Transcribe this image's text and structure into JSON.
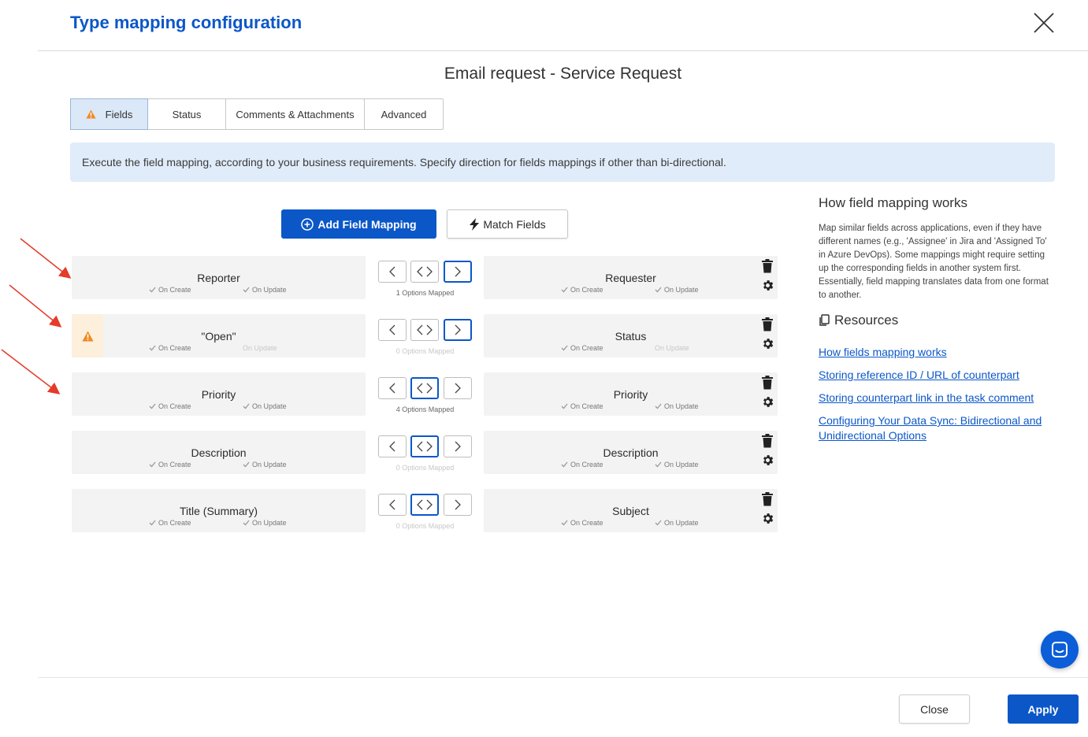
{
  "header": {
    "title": "Type mapping configuration"
  },
  "subtitle": "Email request - Service Request",
  "tabs": [
    {
      "label": "Fields",
      "active": true
    },
    {
      "label": "Status"
    },
    {
      "label": "Comments & Attachments"
    },
    {
      "label": "Advanced"
    }
  ],
  "info_banner": "Execute the field mapping, according to your business requirements. Specify direction for fields mappings if other than bi-directional.",
  "actions": {
    "add_label": "Add Field Mapping",
    "match_label": "Match Fields"
  },
  "mapping_labels": {
    "on_create": "On Create",
    "on_update": "On Update"
  },
  "mappings": [
    {
      "left": "Reporter",
      "right": "Requester",
      "direction": "right",
      "options": "1 Options Mapped",
      "options_active": true,
      "warning": false,
      "left_update_active": true,
      "right_update_active": true
    },
    {
      "left": "\"Open\"",
      "right": "Status",
      "direction": "right",
      "options": "0 Options Mapped",
      "options_active": false,
      "warning": true,
      "left_update_active": false,
      "right_update_active": false
    },
    {
      "left": "Priority",
      "right": "Priority",
      "direction": "both",
      "options": "4 Options Mapped",
      "options_active": true,
      "warning": false,
      "left_update_active": true,
      "right_update_active": true
    },
    {
      "left": "Description",
      "right": "Description",
      "direction": "both",
      "options": "0 Options Mapped",
      "options_active": false,
      "warning": false,
      "left_update_active": true,
      "right_update_active": true
    },
    {
      "left": "Title (Summary)",
      "right": "Subject",
      "direction": "both",
      "options": "0 Options Mapped",
      "options_active": false,
      "warning": false,
      "left_update_active": true,
      "right_update_active": true
    }
  ],
  "help": {
    "title": "How field mapping works",
    "text": "Map similar fields across applications, even if they have different names (e.g., 'Assignee' in Jira and 'Assigned To' in Azure DevOps). Some mappings might require setting up the corresponding fields in another system first. Essentially, field mapping translates data from one format to another.",
    "resources_title": "Resources",
    "links": [
      "How fields mapping works",
      "Storing reference ID / URL of counterpart",
      "Storing counterpart link in the task comment",
      "Configuring Your Data Sync: Bidirectional and Unidirectional Options"
    ]
  },
  "footer": {
    "close_label": "Close",
    "apply_label": "Apply"
  },
  "colors": {
    "primary": "#0b57c8",
    "warning": "#f08a24",
    "annotation": "#e53b2a"
  }
}
